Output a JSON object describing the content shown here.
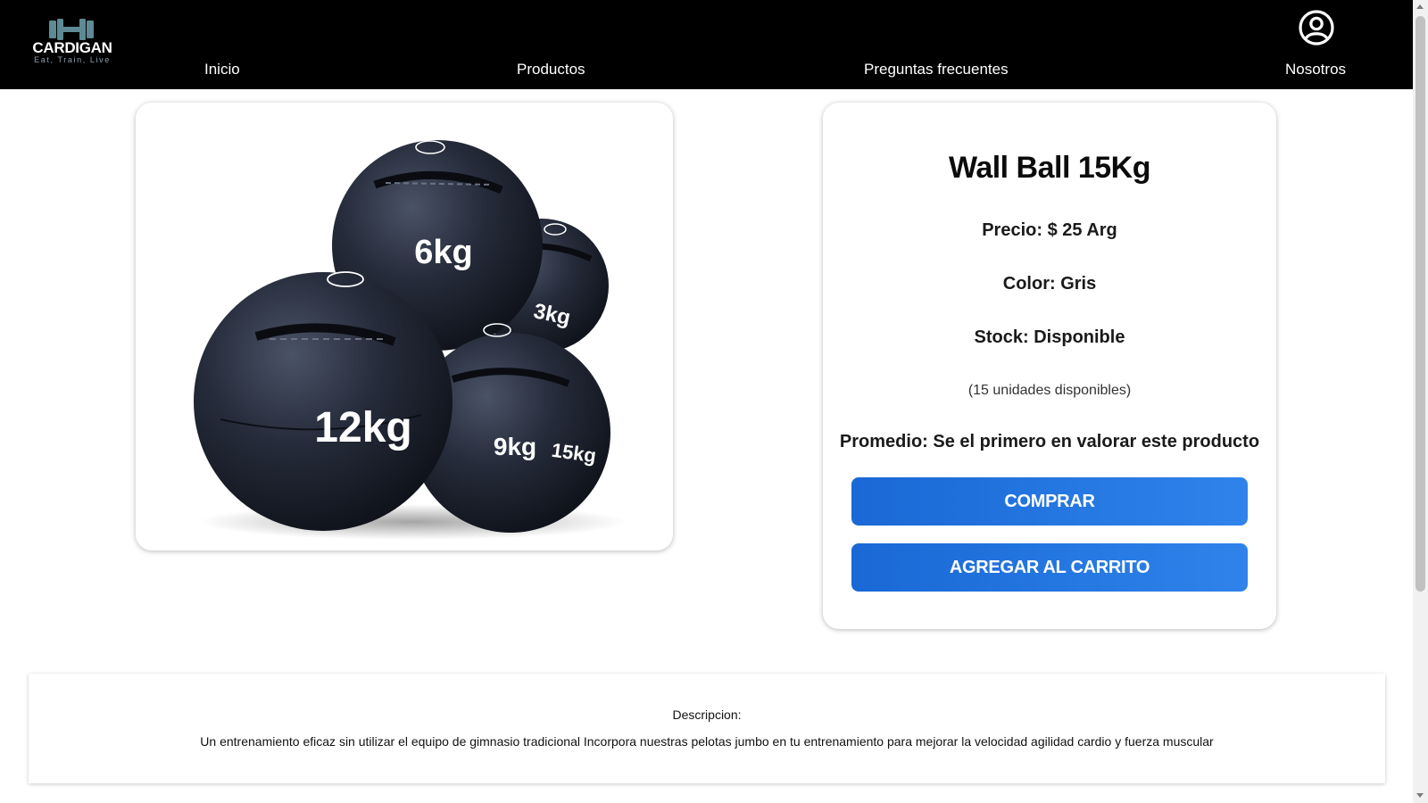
{
  "brand": {
    "name": "CARDIGAN",
    "tagline": "Eat, Train, Live"
  },
  "nav": {
    "items": [
      {
        "label": "Inicio"
      },
      {
        "label": "Productos"
      },
      {
        "label": "Preguntas frecuentes"
      },
      {
        "label": "Nosotros"
      }
    ],
    "account_icon": "user-circle-icon"
  },
  "product": {
    "image_labels": [
      "6kg",
      "3kg",
      "12kg",
      "9kg",
      "15kg"
    ],
    "title": "Wall Ball 15Kg",
    "price": "Precio: $ 25 Arg",
    "color": "Color: Gris",
    "stock": "Stock: Disponible",
    "units": "(15 unidades disponibles)",
    "average": "Promedio: Se el primero en valorar este producto",
    "buy_label": "COMPRAR",
    "cart_label": "AGREGAR AL CARRITO"
  },
  "description": {
    "title": "Descripcion:",
    "text": "Un entrenamiento eficaz sin utilizar el equipo de gimnasio tradicional Incorpora nuestras pelotas jumbo en tu entrenamiento para mejorar la velocidad agilidad cardio y fuerza muscular"
  },
  "colors": {
    "header_bg": "#000000",
    "button": "#1f6fde",
    "ball": "#1c2230"
  }
}
